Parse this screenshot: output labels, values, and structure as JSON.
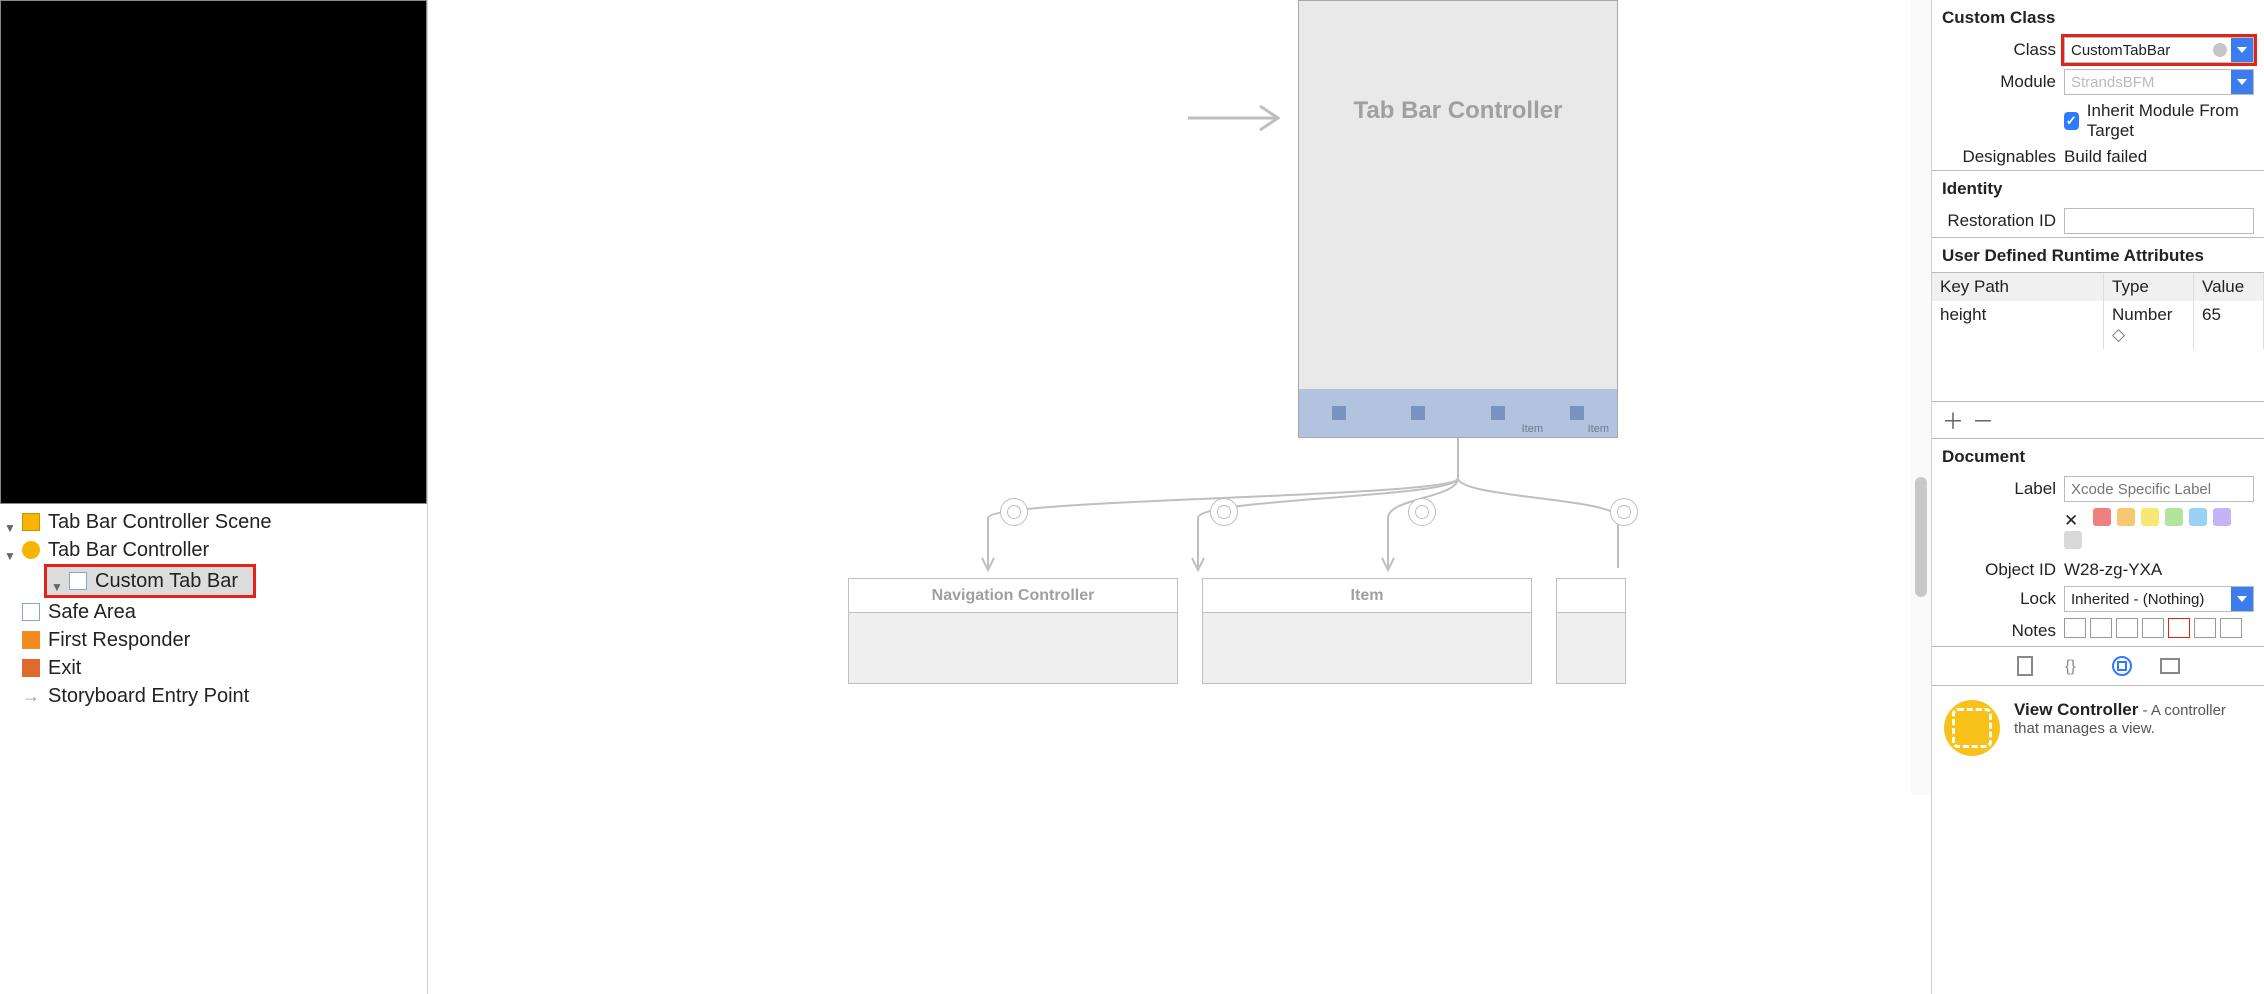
{
  "outline": {
    "scene": "Tab Bar Controller Scene",
    "items": [
      "Tab Bar Controller",
      "Custom Tab Bar",
      "Safe Area",
      "First Responder",
      "Exit",
      "Storyboard Entry Point"
    ]
  },
  "canvas": {
    "tab_controller_title": "Tab Bar Controller",
    "tab_items": [
      "Item",
      "Item"
    ],
    "children": [
      {
        "title": "Navigation Controller"
      },
      {
        "title": "Item"
      },
      {
        "title": ""
      }
    ]
  },
  "inspector": {
    "custom_class": {
      "header": "Custom Class",
      "class_label": "Class",
      "class_value": "CustomTabBar",
      "module_label": "Module",
      "module_placeholder": "StrandsBFM",
      "inherit_label": "Inherit Module From Target",
      "designables_label": "Designables",
      "designables_value": "Build failed"
    },
    "identity": {
      "header": "Identity",
      "restoration_label": "Restoration ID"
    },
    "udra": {
      "header": "User Defined Runtime Attributes",
      "col_key": "Key Path",
      "col_type": "Type",
      "col_value": "Value",
      "row_key": "height",
      "row_type": "Number",
      "row_value": "65"
    },
    "document": {
      "header": "Document",
      "label_label": "Label",
      "label_placeholder": "Xcode Specific Label",
      "objectid_label": "Object ID",
      "objectid_value": "W28-zg-YXA",
      "lock_label": "Lock",
      "lock_value": "Inherited - (Nothing)",
      "notes_label": "Notes",
      "swatch_colors": [
        "#f08080",
        "#f7c873",
        "#f7e873",
        "#b3e49b",
        "#9bd0f7",
        "#c4b3f7",
        "#d9d9d9"
      ]
    },
    "library": {
      "title": "View Controller",
      "desc": " - A controller that manages a view."
    }
  }
}
